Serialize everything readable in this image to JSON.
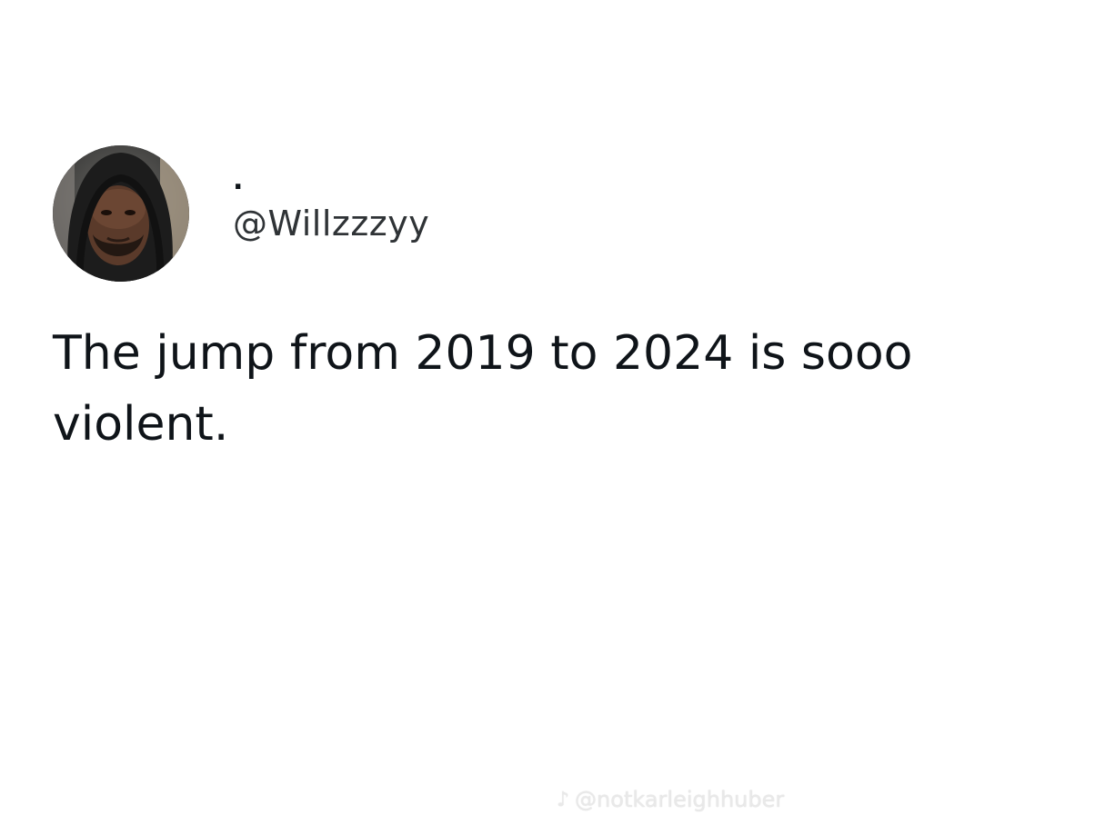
{
  "tweet": {
    "display_name": ".",
    "handle": "@Willzzzyy",
    "text": "The jump from 2019 to 2024 is sooo violent.",
    "avatar_icon": "profile-photo"
  },
  "watermark": {
    "icon": "tiktok-icon",
    "icon_glyph": "♪",
    "text": "@notkarleighhuber"
  }
}
